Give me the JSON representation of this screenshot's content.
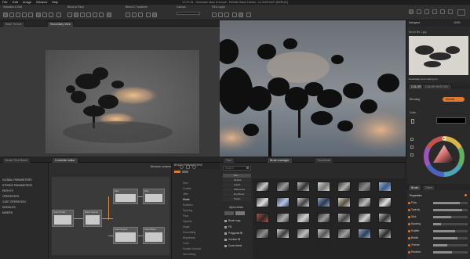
{
  "window": {
    "title": "17:37:15 - Serenade dans la brume - Rebelle Black Harbor - v1.2025.0427 [DEBUG]"
  },
  "menu": {
    "items": [
      "File",
      "Edit",
      "Image",
      "Window",
      "Help"
    ]
  },
  "toolbar": {
    "section1": "Selection & Edit",
    "section2": "Brush & Paint",
    "section3": "Blend & Transform",
    "section4": "Canvas",
    "section5": "Fill & Layer"
  },
  "left_top_tabs": [
    "Base Texture",
    "Secondary View"
  ],
  "left_bottom_tabs": [
    "Brush Tree Brush",
    "Controller editor"
  ],
  "tree": {
    "items": [
      "GLOBAL PARAMETERS",
      "STROKE PARAMETERS",
      "PATH FX",
      "OPERATORS",
      "CAST OPERATION",
      "MODULES",
      "MIXERS"
    ]
  },
  "node_editor": {
    "header_label": "Behavior scheme",
    "nodes": [
      {
        "title": "Color Printer"
      },
      {
        "title": "Brush Source"
      },
      {
        "title": "Size"
      },
      {
        "title": "Size"
      },
      {
        "title": "Color Source"
      },
      {
        "title": "Color Blend"
      }
    ],
    "panel_title": "BRUSH PARAMETERS",
    "panel_items": [
      "Size",
      "Scatter",
      "Jitter",
      "Mode",
      "Rotation",
      "Spacing",
      "Flow",
      "Opacity",
      "Angle",
      "Smoothing",
      "Brightness",
      "Color",
      "Scatter Amount",
      "Smoothing"
    ]
  },
  "brush_panel": {
    "tabs": [
      "Tool",
      "Brush manager",
      "Thumbnail"
    ],
    "search_placeholder": "Search",
    "categories": [
      "Pen",
      "Default",
      "Liquid",
      "Watercolor",
      "Dry Brush",
      "Pastel"
    ],
    "active_category": "Pen",
    "options_title": "Alpha Mode",
    "options": [
      "Brush map",
      "Fill",
      "Polygonal fill",
      "Contour fill",
      "Cover blend"
    ]
  },
  "navigator": {
    "title": "Navigator",
    "zoom": "100%",
    "file_label": "Brush tile 1.jpg",
    "status": "Deactivate zoom during run"
  },
  "color_panel": {
    "tabs": [
      "COLOR",
      "COLOR HISTORY"
    ],
    "blending_label": "Blending",
    "blending_value": "Normal",
    "swatch_label": "Color",
    "swatch_hex": "#000000"
  },
  "brush_props": {
    "tabs": [
      "Brush",
      "Other"
    ],
    "header": "Properties",
    "rows": [
      {
        "label": "Flow",
        "value": 0.78
      },
      {
        "label": "Opacity",
        "value": 0.85
      },
      {
        "label": "Size",
        "value": 0.52
      },
      {
        "label": "Spacing",
        "value": 0.22
      },
      {
        "label": "Scatter",
        "value": 0.64
      },
      {
        "label": "Bristle",
        "value": 0.7
      },
      {
        "label": "Texture",
        "value": 0.41
      },
      {
        "label": "Rotation",
        "value": 0.55
      }
    ]
  },
  "colors": {
    "accent": "#e07a30",
    "panel": "#2a2a2a",
    "dark": "#1e1e1e",
    "sky": "#7c8fa1"
  },
  "icons": [
    "close-icon",
    "search-icon",
    "gear-icon",
    "eyedropper-icon",
    "brush-icon",
    "layer-icon"
  ]
}
